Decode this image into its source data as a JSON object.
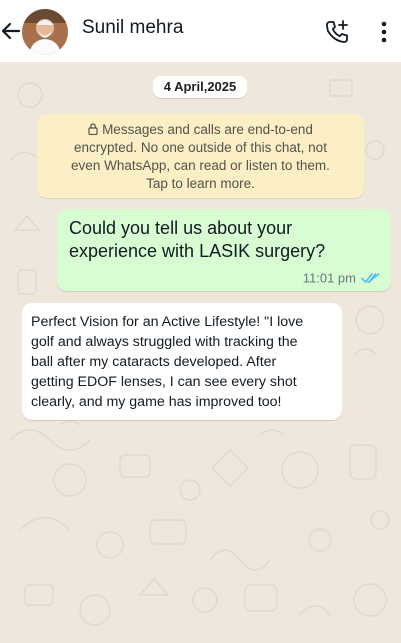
{
  "header": {
    "contact_name": "Sunil mehra"
  },
  "chat": {
    "date_chip": "4 April,2025",
    "encryption_notice": {
      "lines": [
        "Messages and calls are end-to-end",
        "encrypted. No one outside of this chat, not",
        "even WhatsApp, can read or listen to them.",
        "Tap to learn more."
      ]
    },
    "messages": [
      {
        "direction": "outgoing",
        "lines": [
          "Could you tell us about your",
          "experience with LASIK surgery?"
        ],
        "time": "11:01 pm",
        "status": "read"
      },
      {
        "direction": "incoming",
        "lines": [
          "Perfect Vision for an Active Lifestyle! \"I love",
          "golf and always struggled with tracking the",
          "ball after my cataracts developed. After",
          "getting EDOF lenses, I can see every shot",
          "clearly, and my game has improved too!"
        ]
      }
    ]
  },
  "colors": {
    "wallpaper": "#efe7dc",
    "header_background": "#ffffff",
    "outgoing_bubble": "#d9fdd3",
    "incoming_bubble": "#ffffff",
    "encryption_notice_background": "#fcefc5",
    "read_ticks": "#53bdeb"
  },
  "icons": {
    "back": "arrow-left-icon",
    "call": "add-call-icon",
    "menu": "vertical-dots-icon",
    "lock": "lock-icon",
    "read_status": "double-check-icon"
  }
}
